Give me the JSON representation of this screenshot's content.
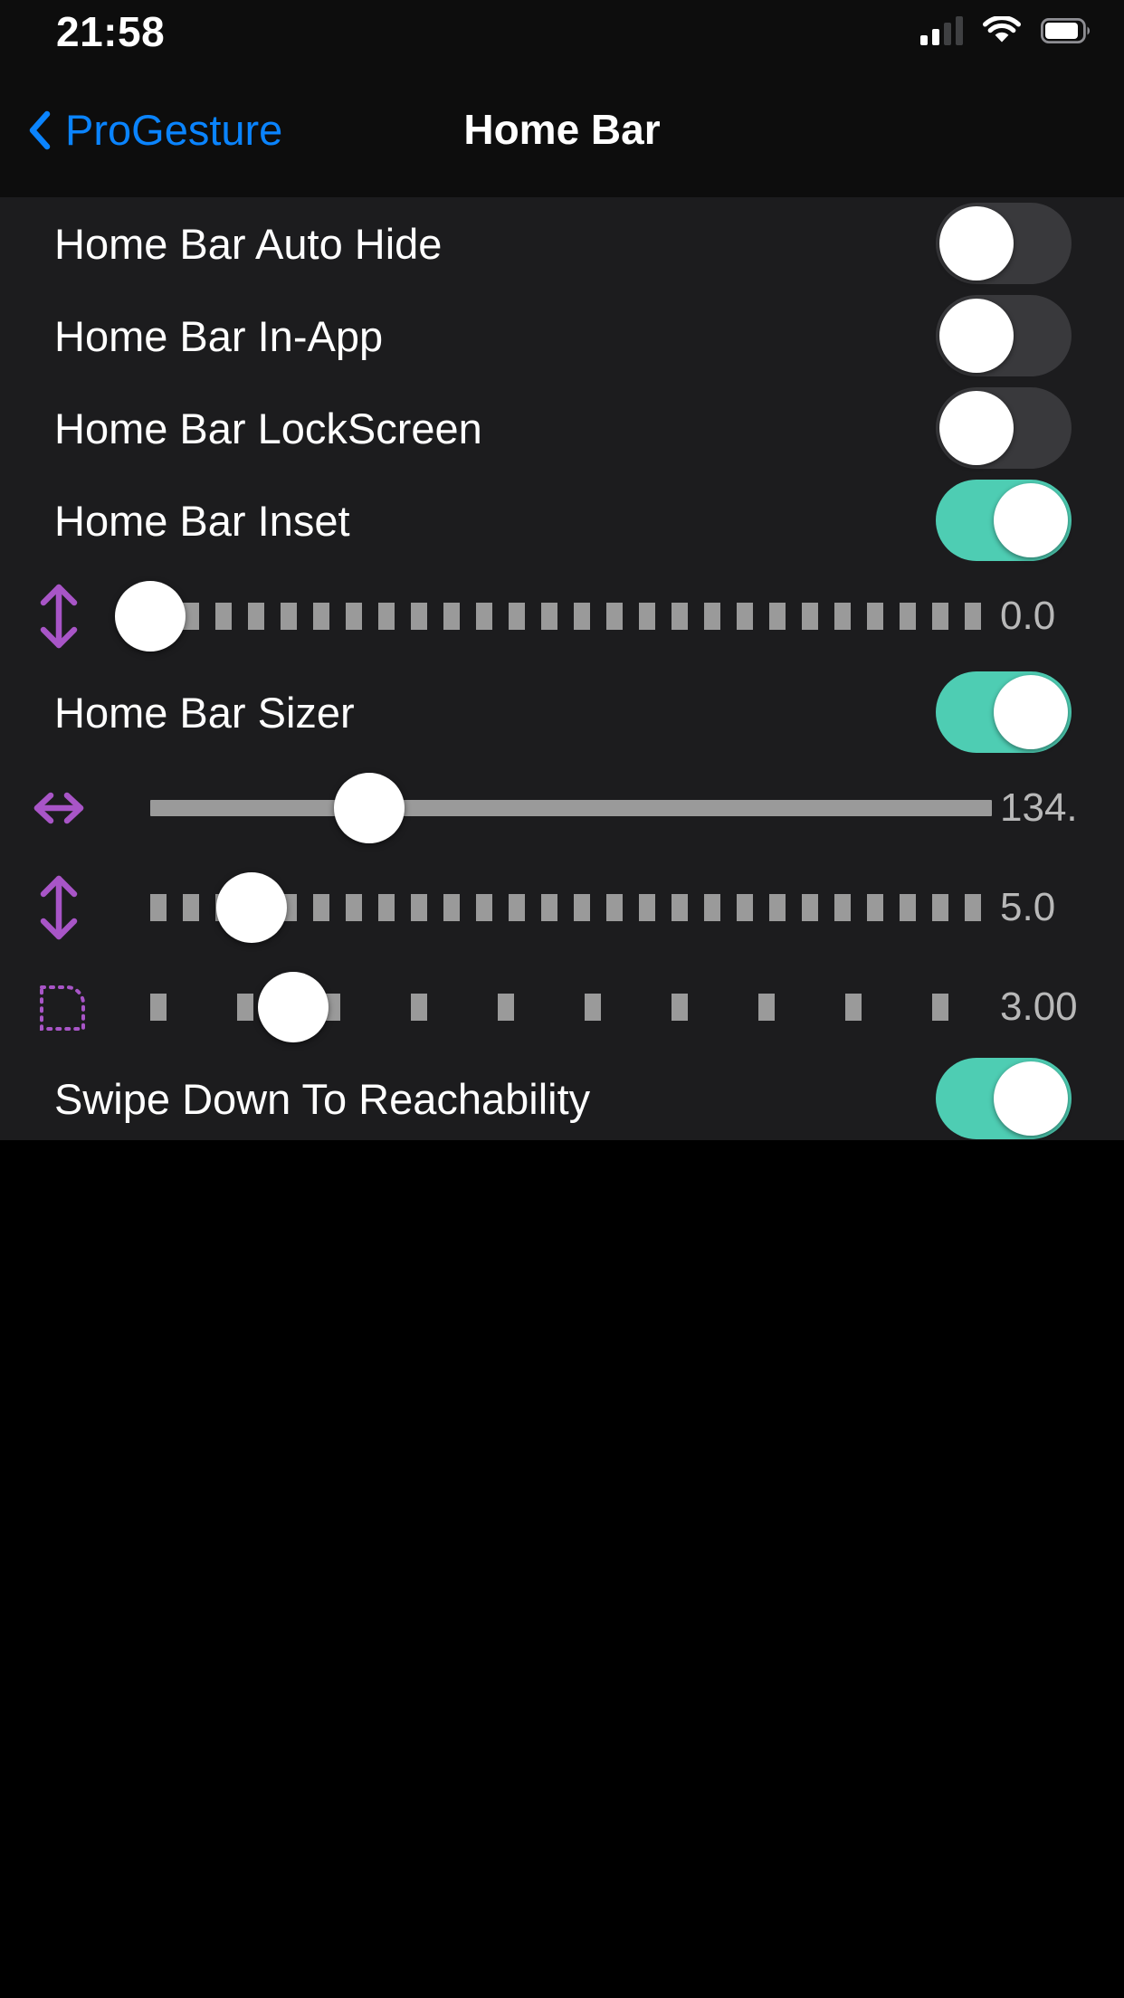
{
  "status_bar": {
    "time": "21:58",
    "signal_icon": "cellular-signal-icon",
    "signal_bars_filled": 2,
    "signal_bars_total": 4,
    "wifi_icon": "wifi-icon",
    "battery_icon": "battery-icon",
    "battery_level_percent": 82
  },
  "nav_bar": {
    "back_label": "ProGesture",
    "back_icon": "chevron-left-icon",
    "title": "Home Bar",
    "back_tint_color": "#0a84ff"
  },
  "theme": {
    "background": "#000000",
    "group_background": "#1c1c1e",
    "toggle_on_color": "#4ecdb3",
    "toggle_off_color": "#39393c",
    "slider_track_color": "#9a9a9a",
    "slider_icon_color": "#a855c7",
    "value_text_color": "#b8b8b8"
  },
  "rows": [
    {
      "type": "switch",
      "label": "Home Bar Auto Hide",
      "value": "off"
    },
    {
      "type": "switch",
      "label": "Home Bar In-App",
      "value": "off"
    },
    {
      "type": "switch",
      "label": "Home Bar LockScreen",
      "value": "off"
    },
    {
      "type": "switch",
      "label": "Home Bar Inset",
      "value": "on"
    },
    {
      "type": "slider",
      "icon": "arrows-vertical-icon",
      "value": "0.0",
      "fill_percent": 0,
      "track_style": "ticked-dense"
    },
    {
      "type": "switch",
      "label": "Home Bar Sizer",
      "value": "on"
    },
    {
      "type": "slider",
      "icon": "arrows-horizontal-icon",
      "value": "134.",
      "fill_percent": 33,
      "track_style": "solid"
    },
    {
      "type": "slider",
      "icon": "arrows-vertical-icon",
      "value": "5.0",
      "fill_percent": 17,
      "track_style": "ticked-dense"
    },
    {
      "type": "slider",
      "icon": "corner-radius-icon",
      "value": "3.00",
      "fill_percent": 22,
      "track_style": "ticked-sparse"
    },
    {
      "type": "switch",
      "label": "Swipe Down To Reachability",
      "value": "on"
    }
  ]
}
